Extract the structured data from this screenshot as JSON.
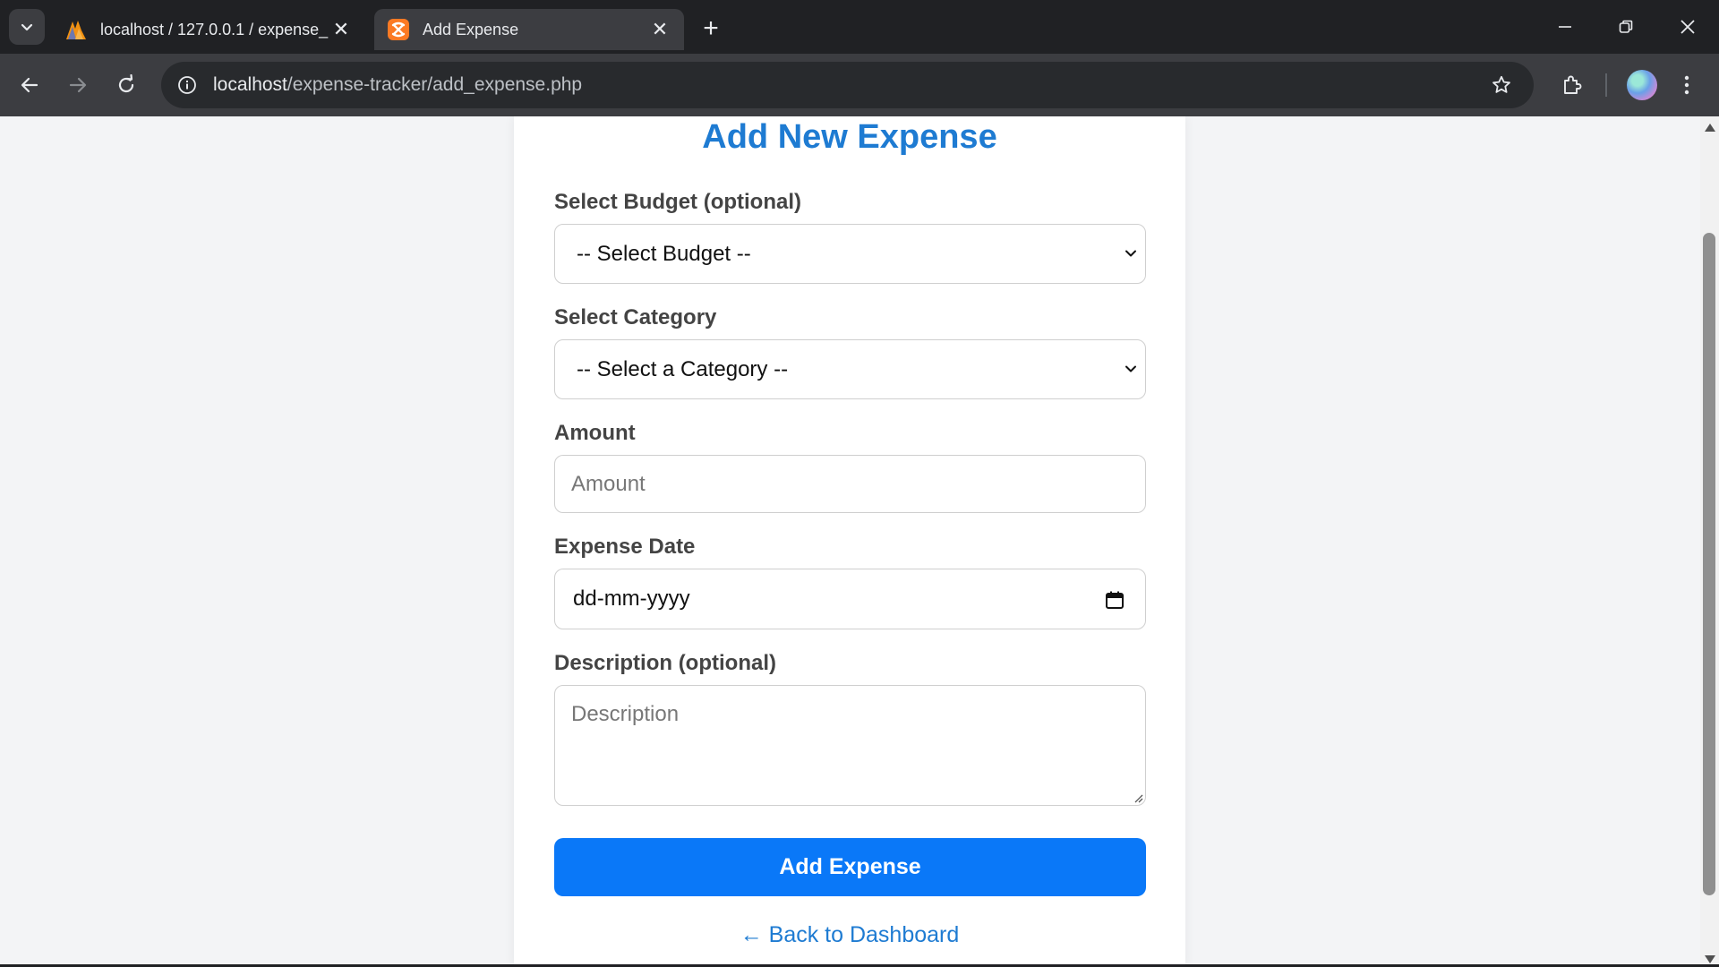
{
  "browser": {
    "tabs": [
      {
        "title": "localhost / 127.0.0.1 / expense_",
        "active": false,
        "favicon": "phpmyadmin-icon"
      },
      {
        "title": "Add Expense",
        "active": true,
        "favicon": "xampp-icon"
      }
    ],
    "url_host": "localhost",
    "url_path": "/expense-tracker/add_expense.php"
  },
  "form": {
    "title": "Add New Expense",
    "budget_label": "Select Budget (optional)",
    "budget_selected": "-- Select Budget --",
    "category_label": "Select Category",
    "category_selected": "-- Select a Category --",
    "amount_label": "Amount",
    "amount_placeholder": "Amount",
    "date_label": "Expense Date",
    "date_value": "dd-mm-yyyy",
    "description_label": "Description (optional)",
    "description_placeholder": "Description",
    "submit_label": "Add Expense",
    "back_link": "← Back to Dashboard"
  },
  "colors": {
    "accent": "#1e7bd2",
    "button": "#0a78f8",
    "chrome_dark": "#202124",
    "chrome_toolbar": "#3c3d41"
  }
}
